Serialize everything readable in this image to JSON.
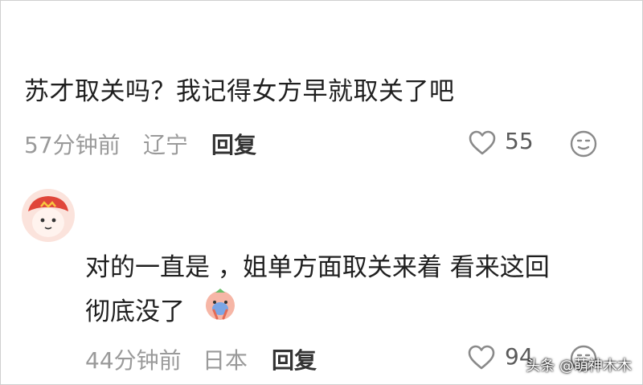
{
  "comments": [
    {
      "text": "苏才取关吗？我记得女方早就取关了吧",
      "time": "57分钟前",
      "location": "辽宁",
      "reply_label": "回复",
      "likes": "55"
    },
    {
      "username": "",
      "text_line1": "对的一直是 ，姐单方面取关来着 看来这回",
      "text_line2": "彻底没了",
      "time": "44分钟前",
      "location": "日本",
      "reply_label": "回复",
      "likes": "94"
    }
  ],
  "watermark": "头条 @萌神木木",
  "colors": {
    "meta_gray": "#9a9a9a",
    "icon_gray": "#8a8a8a",
    "avatar_red": "#e0463a"
  },
  "icons": [
    "heart-icon",
    "smiley-icon",
    "avatar",
    "emoji-sticker"
  ]
}
